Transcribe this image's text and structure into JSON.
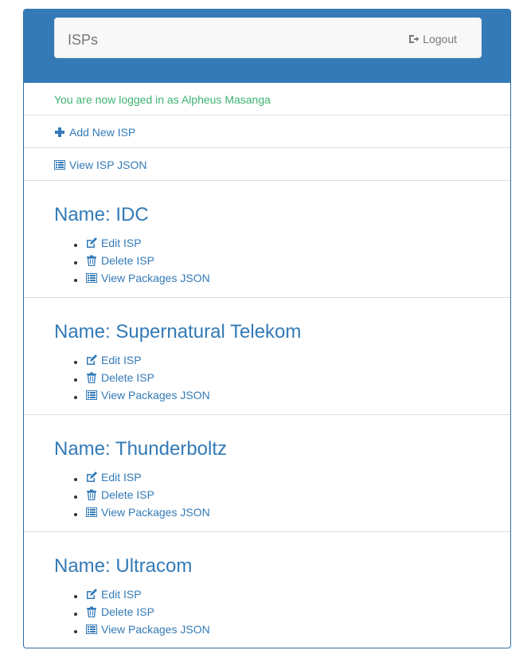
{
  "navbar": {
    "brand": "ISPs",
    "logout_label": "Logout",
    "logout_icon": "logout-icon"
  },
  "flash": {
    "message": "You are now logged in as Alpheus Masanga"
  },
  "actions": {
    "add_new": "Add New ISP",
    "view_json": "View ISP JSON"
  },
  "isps": [
    {
      "name": "Name: IDC",
      "edit": "Edit ISP",
      "delete": "Delete ISP",
      "packages": "View Packages JSON"
    },
    {
      "name": "Name: Supernatural Telekom",
      "edit": "Edit ISP",
      "delete": "Delete ISP",
      "packages": "View Packages JSON"
    },
    {
      "name": "Name: Thunderboltz",
      "edit": "Edit ISP",
      "delete": "Delete ISP",
      "packages": "View Packages JSON"
    },
    {
      "name": "Name: Ultracom",
      "edit": "Edit ISP",
      "delete": "Delete ISP",
      "packages": "View Packages JSON"
    }
  ],
  "colors": {
    "primary": "#337ab7",
    "success_text": "#3cb371",
    "navbar_bg": "#f8f8f8",
    "muted": "#777777"
  }
}
